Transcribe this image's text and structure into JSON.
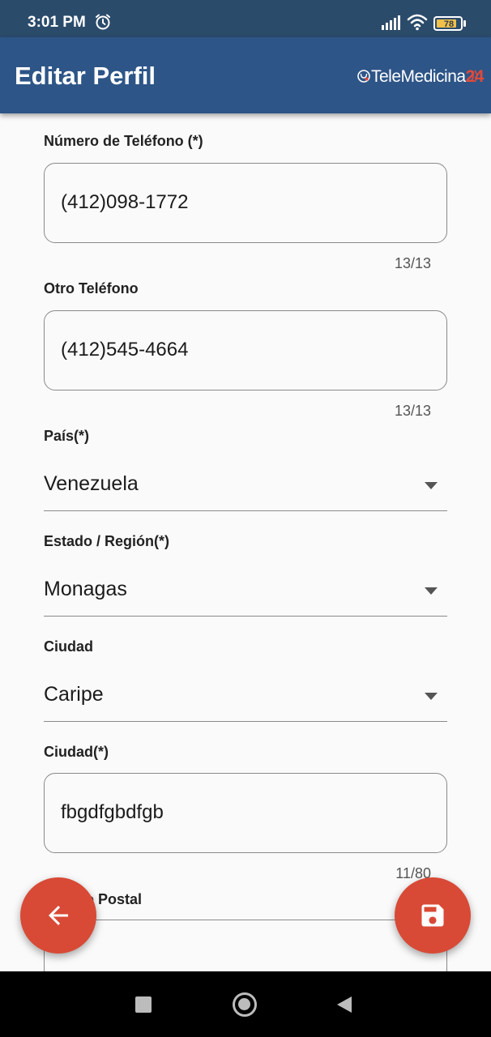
{
  "status_bar": {
    "time": "3:01 PM",
    "battery_level": "78",
    "icons": [
      "alarm-icon",
      "signal-icon",
      "wifi-icon",
      "battery-icon"
    ]
  },
  "app_bar": {
    "title": "Editar Perfil",
    "logo_text": "TeleMedicina",
    "logo_number": "24"
  },
  "form": {
    "phone": {
      "label": "Número de Teléfono (*)",
      "value": "(412)098-1772",
      "counter": "13/13"
    },
    "other_phone": {
      "label": "Otro Teléfono",
      "value": "(412)545-4664",
      "counter": "13/13"
    },
    "country": {
      "label": "País(*)",
      "value": "Venezuela"
    },
    "state": {
      "label": "Estado / Región(*)",
      "value": "Monagas"
    },
    "city_select": {
      "label": "Ciudad",
      "value": "Caripe"
    },
    "city_text": {
      "label": "Ciudad(*)",
      "value": "fbgdfgbdfgb",
      "counter": "11/80"
    },
    "postal": {
      "label": "Código Postal",
      "value": ""
    }
  },
  "fabs": {
    "back_icon": "arrow-back-icon",
    "save_icon": "save-icon"
  },
  "colors": {
    "status_bar": "#2b4b6b",
    "app_bar": "#2d5587",
    "fab": "#d84a36",
    "logo_accent": "#e04a3a"
  },
  "nav_bar": {
    "icons": [
      "recents-square-icon",
      "home-circle-icon",
      "back-triangle-icon"
    ]
  }
}
